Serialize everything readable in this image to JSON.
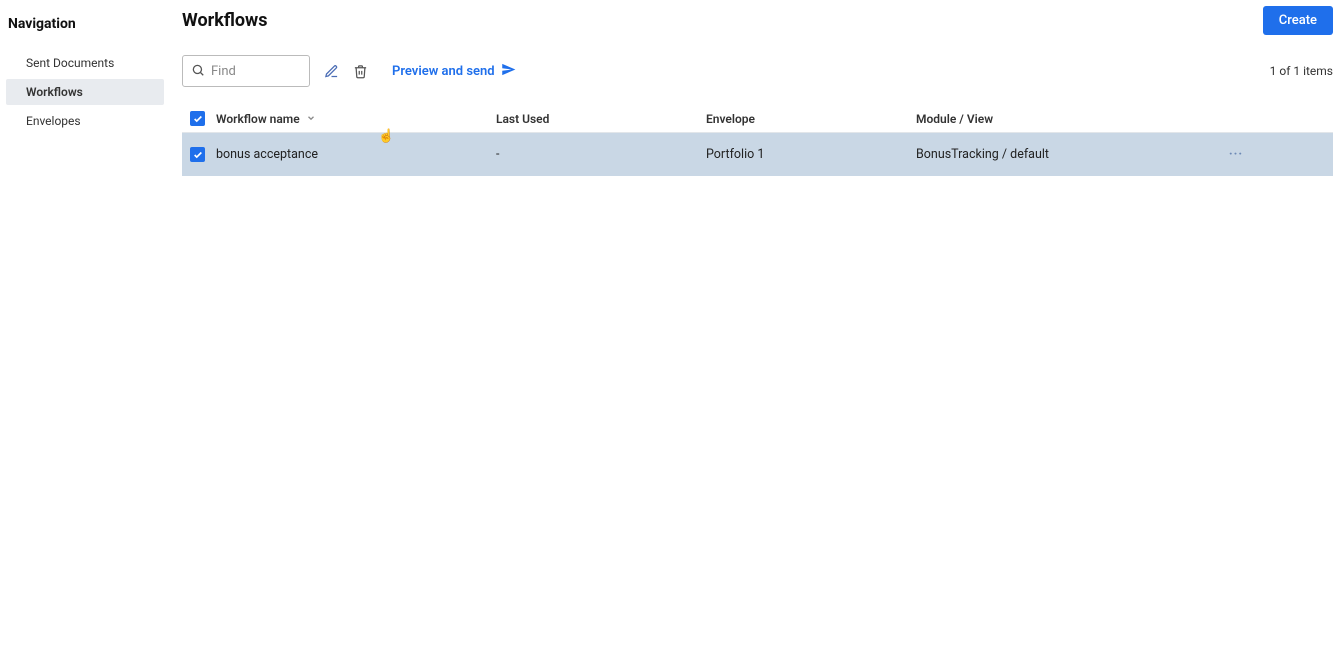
{
  "sidebar": {
    "title": "Navigation",
    "items": [
      {
        "label": "Sent Documents",
        "active": false
      },
      {
        "label": "Workflows",
        "active": true
      },
      {
        "label": "Envelopes",
        "active": false
      }
    ]
  },
  "header": {
    "title": "Workflows",
    "create_label": "Create"
  },
  "toolbar": {
    "search_placeholder": "Find",
    "preview_label": "Preview and send",
    "items_count": "1 of 1 items"
  },
  "table": {
    "headers": {
      "name": "Workflow name",
      "lastUsed": "Last Used",
      "envelope": "Envelope",
      "module": "Module / View"
    },
    "rows": [
      {
        "checked": true,
        "name": "bonus acceptance",
        "lastUsed": "-",
        "envelope": "Portfolio 1",
        "module": "BonusTracking / default"
      }
    ]
  }
}
